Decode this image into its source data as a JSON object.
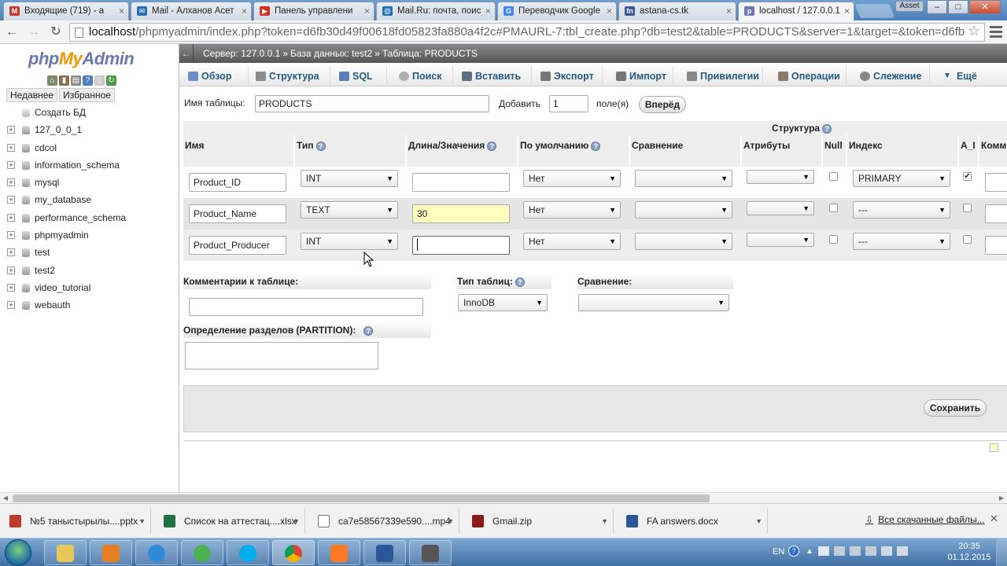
{
  "browser": {
    "tabs": [
      {
        "title": "Входящие (719) - a",
        "icon_color": "#c0392b",
        "icon": "gmail-icon"
      },
      {
        "title": "Mail - Алханов Асет",
        "icon_color": "#2b6cb5",
        "icon": "mail-icon"
      },
      {
        "title": "Панель управлени",
        "icon_color": "#d62d20",
        "icon": "youtube-icon"
      },
      {
        "title": "Mail.Ru: почта, поис",
        "icon_color": "#1f6fb5",
        "icon": "mailru-icon"
      },
      {
        "title": "Переводчик Google",
        "icon_color": "#4285f4",
        "icon": "translate-icon"
      },
      {
        "title": "astana-cs.tk",
        "icon_color": "#3b5998",
        "icon": "fn-icon"
      },
      {
        "title": "localhost / 127.0.0.1",
        "icon_color": "#6c78af",
        "icon": "pma-icon"
      }
    ],
    "user_label": "Asset",
    "url_host": "localhost",
    "url_rest": "/phpmyadmin/index.php?token=d6fb30d49f00618fd05823fa880a4f2c#PMAURL-7:tbl_create.php?db=test2&table=PRODUCTS&server=1&target=&token=d6fb"
  },
  "sidebar": {
    "logo_php": "php",
    "logo_my": "My",
    "logo_admin": "Admin",
    "recent": "Недавнее",
    "favorites": "Избранное",
    "create_db": "Создать БД",
    "databases": [
      "127_0_0_1",
      "cdcol",
      "information_schema",
      "mysql",
      "my_database",
      "performance_schema",
      "phpmyadmin",
      "test",
      "test2",
      "video_tutorial",
      "webauth"
    ]
  },
  "breadcrumb": {
    "server": "Сервер: 127.0.0.1",
    "database": "База данных: test2",
    "table": "Таблица: PRODUCTS"
  },
  "menu": {
    "tabs": [
      "Обзор",
      "Структура",
      "SQL",
      "Поиск",
      "Вставить",
      "Экспорт",
      "Импорт",
      "Привилегии",
      "Операции",
      "Слежение",
      "Ещё"
    ]
  },
  "form": {
    "table_name_label": "Имя таблицы:",
    "table_name_value": "PRODUCTS",
    "add_label": "Добавить",
    "add_value": "1",
    "fields_label": "поле(я)",
    "go_button": "Вперёд",
    "structure_title": "Структура",
    "columns": {
      "name": "Имя",
      "type": "Тип",
      "length": "Длина/Значения",
      "default": "По умолчанию",
      "collation": "Сравнение",
      "attributes": "Атрибуты",
      "null": "Null",
      "index": "Индекс",
      "ai": "A_I",
      "comments": "Комм"
    },
    "rows": [
      {
        "name": "Product_ID",
        "type": "INT",
        "length": "",
        "default": "Нет",
        "collation": "",
        "attributes": "",
        "null": false,
        "index": "PRIMARY",
        "ai": true
      },
      {
        "name": "Product_Name",
        "type": "TEXT",
        "length": "30",
        "default": "Нет",
        "collation": "",
        "attributes": "",
        "null": false,
        "index": "---",
        "ai": false
      },
      {
        "name": "Product_Producer",
        "type": "INT",
        "length": "",
        "default": "Нет",
        "collation": "",
        "attributes": "",
        "null": false,
        "index": "---",
        "ai": false
      }
    ],
    "table_comments_label": "Комментарии к таблице:",
    "engine_label": "Тип таблиц:",
    "engine_value": "InnoDB",
    "collation_label": "Сравнение:",
    "partition_label": "Определение разделов (PARTITION):",
    "save_button": "Сохранить"
  },
  "downloads": {
    "items": [
      {
        "name": "№5 таныстырылы....pptx",
        "color": "#c0392b"
      },
      {
        "name": "Список на аттестац....xlsx",
        "color": "#1e7145"
      },
      {
        "name": "ca7e58567339e590....mp4",
        "color": "#555555"
      },
      {
        "name": "Gmail.zip",
        "color": "#8b1a1a"
      },
      {
        "name": "FA answers.docx",
        "color": "#2b579a"
      }
    ],
    "all_downloads": "Все скачанные файлы..."
  },
  "taskbar": {
    "lang": "EN",
    "time": "20:35",
    "date": "01.12.2015"
  }
}
